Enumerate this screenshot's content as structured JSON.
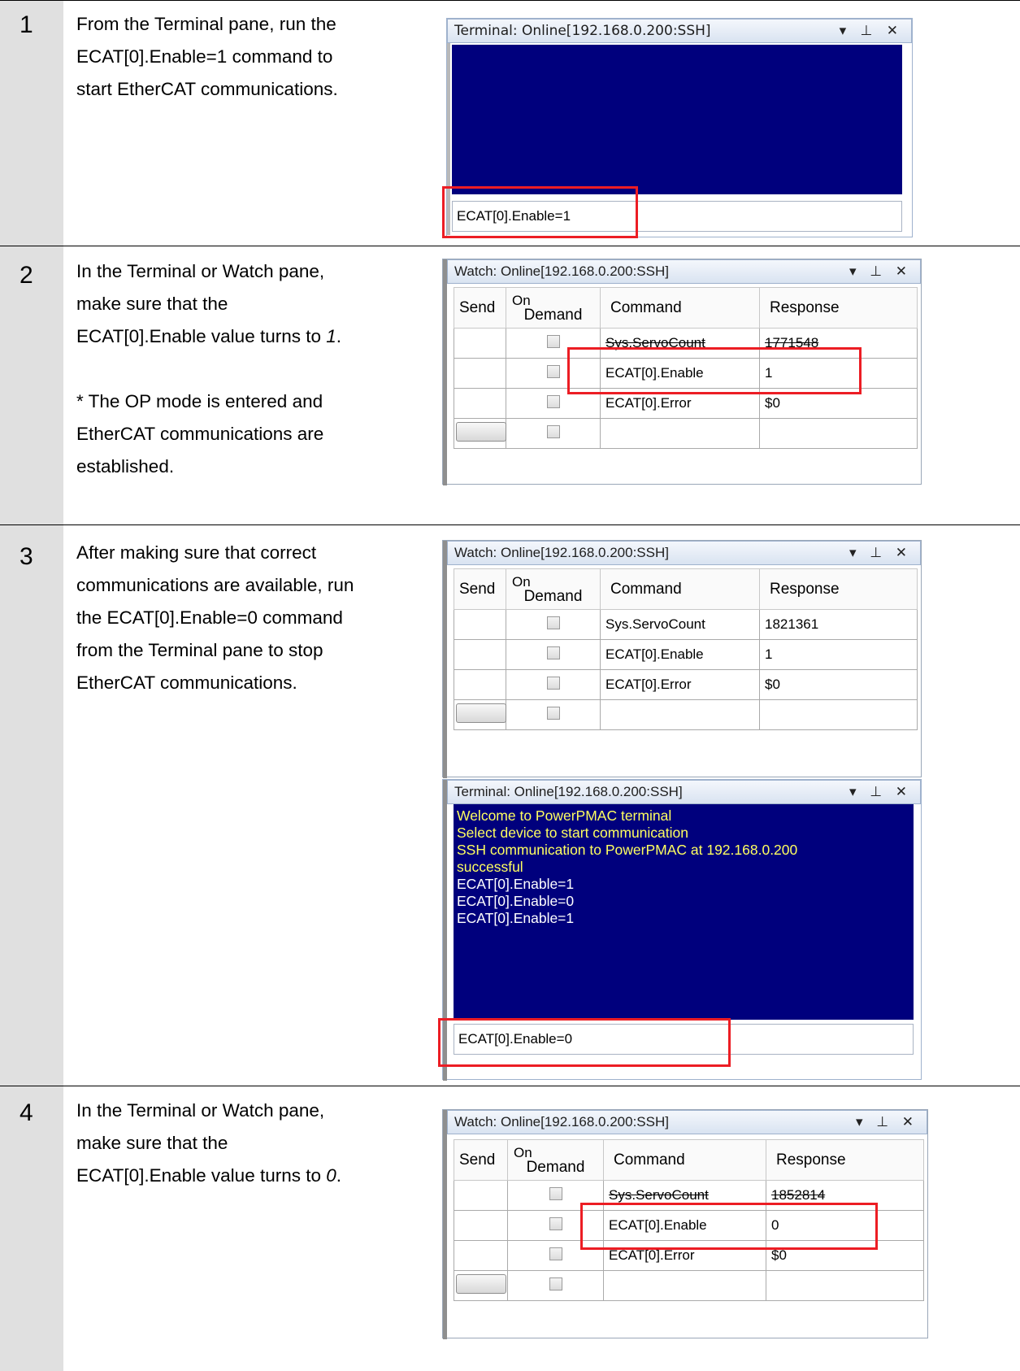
{
  "steps": [
    {
      "number": "1",
      "text_lines": [
        "From the Terminal pane, run the",
        "ECAT[0].Enable=1 command to",
        "start EtherCAT communications."
      ]
    },
    {
      "number": "2",
      "text_lines": [
        "In the Terminal or Watch pane,",
        "make sure that the",
        "ECAT[0].Enable value turns to ",
        "* The OP mode is entered and",
        "EtherCAT communications are",
        "established."
      ],
      "italic_value": "1",
      "period": "."
    },
    {
      "number": "3",
      "text_lines": [
        "After making sure that correct",
        "communications are available, run",
        "the ECAT[0].Enable=0 command",
        "from the Terminal pane to stop",
        "EtherCAT communications."
      ]
    },
    {
      "number": "4",
      "text_lines": [
        "In the Terminal or Watch pane,",
        "make sure that the",
        "ECAT[0].Enable value turns to "
      ],
      "italic_value": "0",
      "period": "."
    }
  ],
  "terminal1": {
    "title": "Terminal: Online[192.168.0.200:SSH]",
    "input_value": "ECAT[0].Enable=1"
  },
  "watch_headers": {
    "send": "Send",
    "on": "On",
    "demand": "Demand",
    "command": "Command",
    "response": "Response"
  },
  "watch2": {
    "title": "Watch: Online[192.168.0.200:SSH]",
    "rows": [
      {
        "command": "Sys.ServoCount",
        "response": "1771548"
      },
      {
        "command": "ECAT[0].Enable",
        "response": "1"
      },
      {
        "command": "ECAT[0].Error",
        "response": "$0"
      }
    ]
  },
  "watch3": {
    "title": "Watch: Online[192.168.0.200:SSH]",
    "rows": [
      {
        "command": "Sys.ServoCount",
        "response": "1821361"
      },
      {
        "command": "ECAT[0].Enable",
        "response": "1"
      },
      {
        "command": "ECAT[0].Error",
        "response": "$0"
      }
    ]
  },
  "terminal3": {
    "title": "Terminal: Online[192.168.0.200:SSH]",
    "lines_yellow": [
      "Welcome to PowerPMAC terminal",
      "Select device to start communication",
      "SSH communication to PowerPMAC at 192.168.0.200",
      "successful"
    ],
    "lines_white": [
      "ECAT[0].Enable=1",
      "ECAT[0].Enable=0",
      "ECAT[0].Enable=1"
    ],
    "input_value": "ECAT[0].Enable=0"
  },
  "watch4": {
    "title": "Watch: Online[192.168.0.200:SSH]",
    "rows": [
      {
        "command": "Sys.ServoCount",
        "response": "1852814"
      },
      {
        "command": "ECAT[0].Enable",
        "response": "0"
      },
      {
        "command": "ECAT[0].Error",
        "response": "$0"
      }
    ]
  },
  "pane_icons": "▾ ⊥ ✕",
  "colors": {
    "highlight": "#ec1d24",
    "terminal_bg": "#00007d",
    "terminal_text": "#ffff60"
  }
}
